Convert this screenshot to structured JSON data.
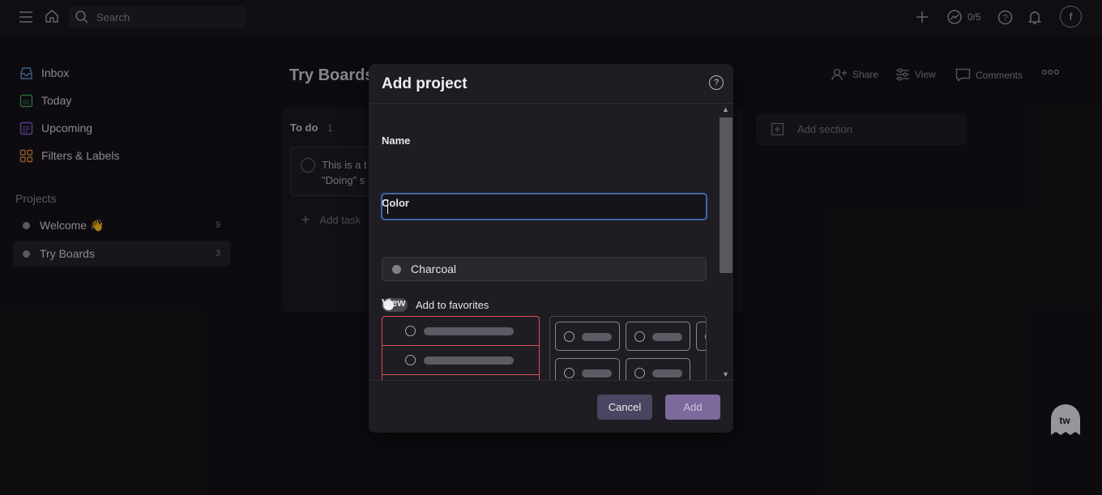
{
  "topbar": {
    "search_placeholder": "Search",
    "karma": "0/5",
    "avatar_initial": "f"
  },
  "sidebar": {
    "items": [
      {
        "label": "Inbox",
        "icon": "inbox-icon"
      },
      {
        "label": "Today",
        "icon": "calendar-today-icon",
        "icon_text": "01"
      },
      {
        "label": "Upcoming",
        "icon": "calendar-upcoming-icon"
      },
      {
        "label": "Filters & Labels",
        "icon": "filters-icon"
      }
    ],
    "projects_header": "Projects",
    "projects": [
      {
        "label": "Welcome 👋",
        "count": "9"
      },
      {
        "label": "Try Boards",
        "count": "3",
        "active": true
      }
    ]
  },
  "main": {
    "title": "Try Boards",
    "actions": {
      "share": "Share",
      "view": "View",
      "comments": "Comments"
    },
    "section": {
      "name": "To do",
      "count": "1"
    },
    "task": {
      "line1": "This is a t",
      "line2": "\"Doing\" s"
    },
    "add_task": "Add task",
    "add_section": "Add section"
  },
  "modal": {
    "title": "Add project",
    "name_label": "Name",
    "name_value": "",
    "color_label": "Color",
    "color_value": "Charcoal",
    "color_hex": "#808080",
    "favorites_label": "Add to favorites",
    "favorites_on": false,
    "view_label": "View",
    "cancel": "Cancel",
    "add": "Add"
  },
  "colors": {
    "accent": "#3f66a8",
    "danger_outline": "#d9534f",
    "add_button": "#7b6a9b",
    "cancel_button": "#4a4560"
  }
}
